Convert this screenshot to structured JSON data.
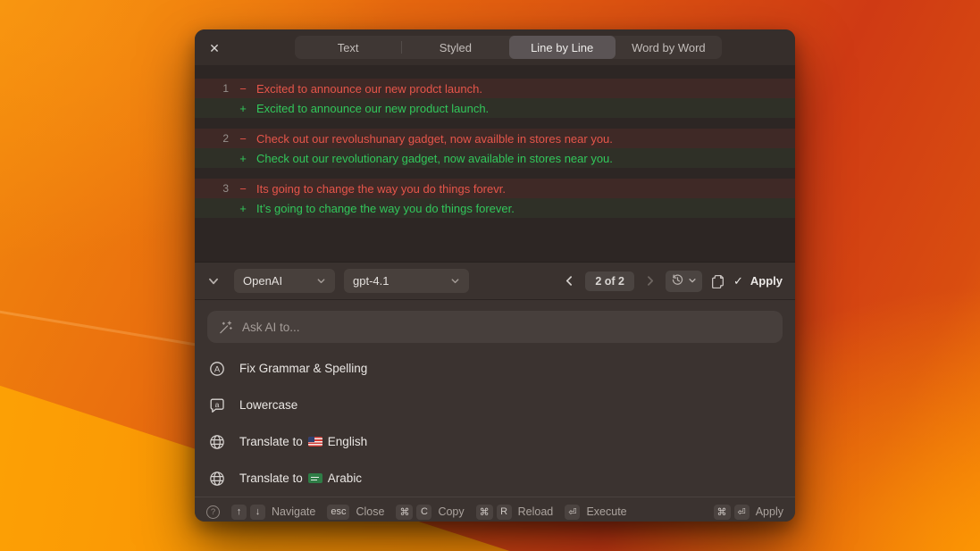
{
  "icons": {
    "close": "✕",
    "check": "✓",
    "help": "?",
    "grammar_letter": "A",
    "bubble_letter": "a"
  },
  "tabs": {
    "items": [
      "Text",
      "Styled",
      "Line by Line",
      "Word by Word"
    ],
    "selected": "Line by Line"
  },
  "diff": {
    "removed_prefix": "−",
    "added_prefix": "+",
    "lines": [
      {
        "number": "1",
        "removed": "Excited to announce our new prodct launch.",
        "added": "Excited to announce our new product launch."
      },
      {
        "number": "2",
        "removed": "Check out our revolushunary gadget, now availble in stores near you.",
        "added": "Check out our revolutionary gadget, now available in stores near you."
      },
      {
        "number": "3",
        "removed": "Its going to change the way you do things forevr.",
        "added": "It’s going to change the way you do things forever."
      }
    ]
  },
  "toolbar": {
    "provider": "OpenAI",
    "model": "gpt-4.1",
    "counter": "2 of 2",
    "apply": "Apply"
  },
  "command_bar": {
    "placeholder": "Ask AI to..."
  },
  "commands": {
    "fix_grammar": "Fix Grammar & Spelling",
    "lowercase": "Lowercase",
    "translate_prefix": "Translate to",
    "english": "English",
    "arabic": "Arabic"
  },
  "footer": {
    "navigate": {
      "k1": "↑",
      "k2": "↓",
      "label": "Navigate"
    },
    "close": {
      "k1": "esc",
      "label": "Close"
    },
    "copy": {
      "k1": "⌘",
      "k2": "C",
      "label": "Copy"
    },
    "reload": {
      "k1": "⌘",
      "k2": "R",
      "label": "Reload"
    },
    "execute": {
      "k1": "⏎",
      "label": "Execute"
    },
    "apply": {
      "k1": "⌘",
      "k2": "⏎",
      "label": "Apply"
    }
  },
  "colors": {
    "removed_text": "#e5554a",
    "added_text": "#31c75b",
    "window_bg": "#3b3330",
    "diff_bg": "#2d2624",
    "wallpaper_orange": "#ef720a"
  }
}
